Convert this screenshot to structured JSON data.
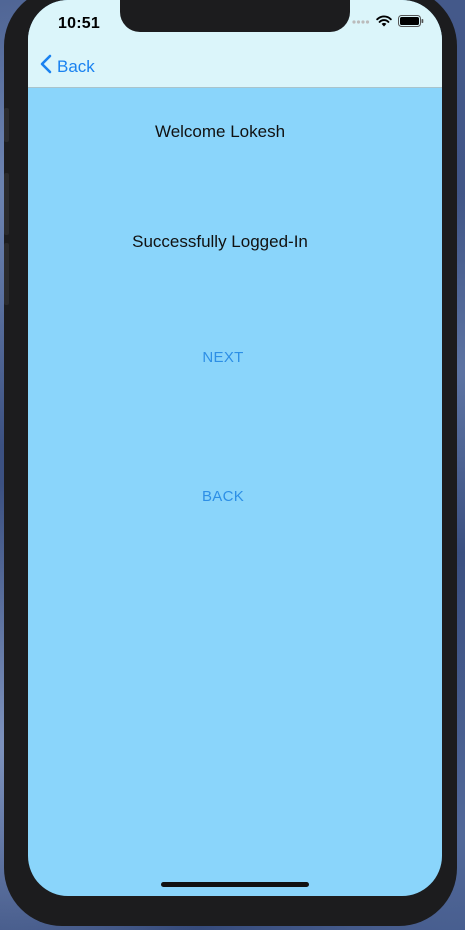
{
  "status_bar": {
    "time": "10:51",
    "icons": [
      "cellular-signal-icon",
      "wifi-icon",
      "battery-icon"
    ]
  },
  "nav_bar": {
    "back_label": "Back",
    "back_icon": "chevron-left-icon"
  },
  "content": {
    "welcome_text": "Welcome Lokesh",
    "status_text": "Successfully Logged-In",
    "next_label": "NEXT",
    "back_label": "BACK"
  },
  "colors": {
    "screen_background": "#8ad5fb",
    "nav_background": "#dbf5fa",
    "accent": "#1a82f0",
    "button_text": "#2d8fe6"
  }
}
